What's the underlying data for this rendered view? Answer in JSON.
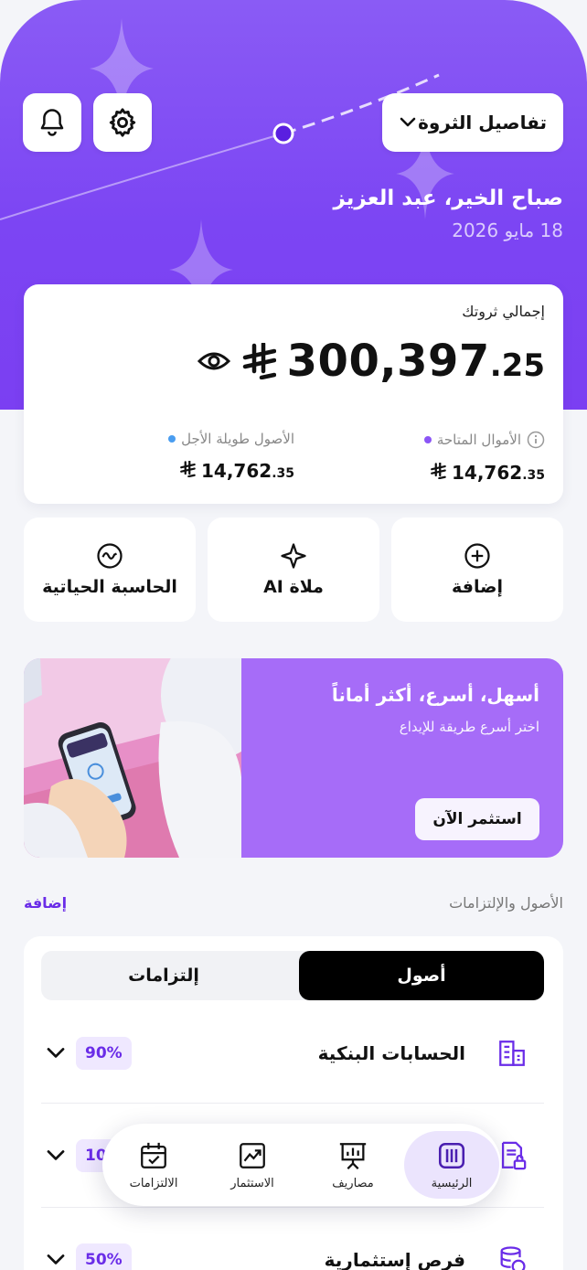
{
  "header": {
    "wealth_dropdown": "تفاصيل الثروة",
    "greeting": "صباح الخير، عبد العزيز",
    "date": "18 مايو 2026"
  },
  "balance": {
    "caption": "إجمالي ثروتك",
    "total_int": "300,397",
    "total_dec": ".25",
    "currency_icon": "riyal-sign-icon",
    "available": {
      "label": "الأموال المتاحة",
      "value": "14,762",
      "dec": ".35",
      "dot_color": "#8b55f6"
    },
    "long_term": {
      "label": "الأصول طويلة الأجل",
      "value": "14,762",
      "dec": ".35",
      "dot_color": "#4a9df0"
    }
  },
  "quick_actions": [
    {
      "label": "إضافة",
      "icon": "plus-circle-icon"
    },
    {
      "label": "ملاة AI",
      "icon": "sparkle-icon"
    },
    {
      "label": "الحاسبة الحياتية",
      "icon": "pulse-circle-icon"
    }
  ],
  "promo": {
    "title": "أسهل، أسرع، أكثر أماناً",
    "subtitle": "اختر  أسرع طريقة للإيداع",
    "cta": "استثمر الآن"
  },
  "assets_section": {
    "title": "الأصول والإلتزامات",
    "add": "إضافة",
    "tabs": [
      "أصول",
      "إلتزامات"
    ],
    "rows": [
      {
        "name": "الحسابات البنكية",
        "percent": "90%",
        "icon": "bank-building-icon"
      },
      {
        "name": "",
        "percent": "10",
        "icon": "locked-document-icon"
      },
      {
        "name": "فرص إستثمارية",
        "percent": "50%",
        "icon": "coins-stack-icon"
      }
    ]
  },
  "bottom_nav": [
    {
      "label": "الرئيسية",
      "icon": "home-bars-icon",
      "active": true
    },
    {
      "label": "مصاريف",
      "icon": "presentation-board-icon",
      "active": false
    },
    {
      "label": "الاستثمار",
      "icon": "trend-chart-icon",
      "active": false
    },
    {
      "label": "الالتزامات",
      "icon": "calendar-check-icon",
      "active": false
    }
  ],
  "colors": {
    "primary": "#7b3ff2",
    "accent": "#6a2ce8",
    "promo": "#a66cf8"
  }
}
